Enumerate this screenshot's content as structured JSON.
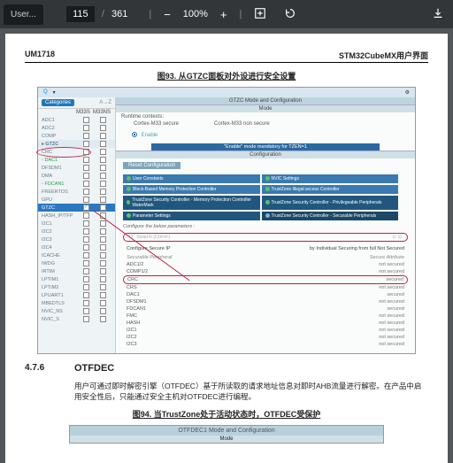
{
  "viewer": {
    "tab": "User...",
    "page": "115",
    "total": "361",
    "zoom": "100%"
  },
  "doc": {
    "id": "UM1718",
    "title": "STM32CubeMX用户界面"
  },
  "fig93": {
    "caption": "图93. 从GTZC面板对外设进行安全设置",
    "categoriesBtn": "Categories",
    "az": "A→Z",
    "colL": "",
    "colM33S": "M33S",
    "colM33NS": "M33NS",
    "gtzcHdr": "GTZC Mode and Configuration",
    "modeHdr": "Mode",
    "runtimeContexts": "Runtime contexts:",
    "cm33s": "Cortex-M33 secure",
    "cm33ns": "Cortex-M33 non secure",
    "enable": "Enable",
    "mand": "\"Enable\" mode mandatory for TZEN=1",
    "cfgHdr": "Configuration",
    "reset": "Reset Configuration",
    "cfgSub": "Configure the below parameters :",
    "searchPh": "Search (Ctrl+F)",
    "secHdrL": "Configure Secure IP",
    "secHdrR": "by Individual Securing from full Not Secured",
    "subL": "Securable Peripheral",
    "subR": "Secure Attribute",
    "left": [
      {
        "n": "ADC1",
        "g": false
      },
      {
        "n": "ADC2",
        "g": false
      },
      {
        "n": "COMP",
        "g": false
      },
      {
        "n": "▸ GTZC",
        "g": true
      },
      {
        "n": "CRC",
        "g": false,
        "circ": true
      },
      {
        "n": "◦ DAC1",
        "g": false,
        "green": true
      },
      {
        "n": "DFSDM1",
        "g": false
      },
      {
        "n": "DMA",
        "g": false
      },
      {
        "n": "◦ FDCAN1",
        "g": false,
        "green": true
      },
      {
        "n": "FREERTOS",
        "g": false
      },
      {
        "n": "GPU",
        "g": false
      },
      {
        "n": "GTZC",
        "g": false,
        "sel": true,
        "ck": true
      },
      {
        "n": "HASH_IP/TFP",
        "g": false
      },
      {
        "n": "I2C1",
        "g": false
      },
      {
        "n": "I2C2",
        "g": false
      },
      {
        "n": "I2C3",
        "g": false
      },
      {
        "n": "I2C4",
        "g": false
      },
      {
        "n": "ICACHE",
        "g": false
      },
      {
        "n": "IWDG",
        "g": false
      },
      {
        "n": "IRTIM",
        "g": false
      },
      {
        "n": "LPTIM1",
        "g": false
      },
      {
        "n": "LPTIM2",
        "g": false
      },
      {
        "n": "LPUART1",
        "g": false
      },
      {
        "n": "MBEDTLS",
        "g": false
      },
      {
        "n": "NVIC_NS",
        "g": false
      },
      {
        "n": "NVIC_S",
        "g": false
      }
    ],
    "btns": [
      {
        "t": "User Constants"
      },
      {
        "t": "NVIC Settings"
      },
      {
        "t": "Block-Based Memory Protection Controller"
      },
      {
        "t": "TrustZone Illegal access Controller"
      },
      {
        "t": "TrustZone Security Controller - Memory Protection Controller WaterMark",
        "dark": true
      },
      {
        "t": "TrustZone Security Controller - Privilegeable Peripherals",
        "dark": true
      },
      {
        "t": "Parameter Settings",
        "dark": true
      },
      {
        "t": "TrustZone Security Controller - Securable Peripherals",
        "dark": true,
        "sel": true
      }
    ],
    "secRows": [
      {
        "l": "ADC1/2",
        "r": "not secured"
      },
      {
        "l": "COMP1/2",
        "r": "not secured"
      },
      {
        "l": "CRC",
        "r": "secured",
        "red": true
      },
      {
        "l": "CRS",
        "r": "not secured"
      },
      {
        "l": "DAC1",
        "r": "secured"
      },
      {
        "l": "DFSDM1",
        "r": "not secured"
      },
      {
        "l": "FDCAN1",
        "r": "secured"
      },
      {
        "l": "FMC",
        "r": "not secured"
      },
      {
        "l": "HASH",
        "r": "not secured"
      },
      {
        "l": "I2C1",
        "r": "not secured"
      },
      {
        "l": "I2C2",
        "r": "not secured"
      },
      {
        "l": "I2C3",
        "r": "not secured"
      }
    ]
  },
  "sect": {
    "num": "4.7.6",
    "title": "OTFDEC",
    "p1": "用户可通过即时解密引擎（OTFDEC）基于所读取的请求地址信息对即时AHB流量进行解密。在产品中启用安全性后，只能通过安全主机对OTFDEC进行编程。"
  },
  "fig94": {
    "caption": "图94. 当TrustZone处于活动状态时，OTFDEC受保护",
    "hdr": "OTFDEC1 Mode and Configuration",
    "mode": "Mode"
  }
}
